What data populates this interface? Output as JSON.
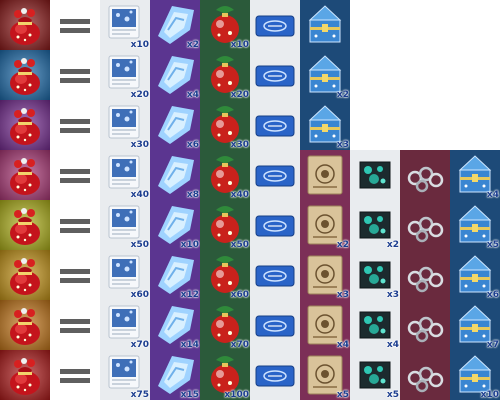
{
  "colors": {
    "bag_backgrounds": [
      "#8f1c1c",
      "#1f6fb0",
      "#7a2f96",
      "#b03a7a",
      "#b3b51c",
      "#c9981a",
      "#c87a1c",
      "#b31c1c"
    ],
    "equals": "#5f5f5f",
    "quantity_text": "#1b3d8f"
  },
  "icons": {
    "gift_bag": "red-gift-bag-icon",
    "equals": "equals-icon",
    "card_scroll": "blue-card-scroll-icon",
    "ice_crystal": "ice-crystal-icon",
    "ornament_ball": "christmas-ornament-icon",
    "blue_ticket": "blue-ticket-icon",
    "treasure_chest": "blue-treasure-chest-icon",
    "parchment": "parchment-scroll-icon",
    "gem_box": "teal-gem-box-icon",
    "chain_pile": "silver-chain-pile-icon"
  },
  "rows": [
    {
      "items": [
        {
          "icon": "card_scroll",
          "qty": "x10"
        },
        {
          "icon": "ice_crystal",
          "qty": "x2"
        },
        {
          "icon": "ornament_ball",
          "qty": "x10"
        },
        {
          "icon": "blue_ticket",
          "qty": ""
        },
        {
          "icon": "treasure_chest",
          "qty": ""
        }
      ]
    },
    {
      "items": [
        {
          "icon": "card_scroll",
          "qty": "x20"
        },
        {
          "icon": "ice_crystal",
          "qty": "x4"
        },
        {
          "icon": "ornament_ball",
          "qty": "x20"
        },
        {
          "icon": "blue_ticket",
          "qty": ""
        },
        {
          "icon": "treasure_chest",
          "qty": "x2"
        }
      ]
    },
    {
      "items": [
        {
          "icon": "card_scroll",
          "qty": "x30"
        },
        {
          "icon": "ice_crystal",
          "qty": "x6"
        },
        {
          "icon": "ornament_ball",
          "qty": "x30"
        },
        {
          "icon": "blue_ticket",
          "qty": ""
        },
        {
          "icon": "treasure_chest",
          "qty": "x3"
        }
      ]
    },
    {
      "items": [
        {
          "icon": "card_scroll",
          "qty": "x40"
        },
        {
          "icon": "ice_crystal",
          "qty": "x8"
        },
        {
          "icon": "ornament_ball",
          "qty": "x40"
        },
        {
          "icon": "blue_ticket",
          "qty": ""
        },
        {
          "icon": "parchment",
          "qty": ""
        },
        {
          "icon": "gem_box",
          "qty": ""
        },
        {
          "icon": "chain_pile",
          "qty": ""
        },
        {
          "icon": "treasure_chest",
          "qty": "x4"
        }
      ]
    },
    {
      "items": [
        {
          "icon": "card_scroll",
          "qty": "x50"
        },
        {
          "icon": "ice_crystal",
          "qty": "x10"
        },
        {
          "icon": "ornament_ball",
          "qty": "x50"
        },
        {
          "icon": "blue_ticket",
          "qty": ""
        },
        {
          "icon": "parchment",
          "qty": "x2"
        },
        {
          "icon": "gem_box",
          "qty": "x2"
        },
        {
          "icon": "chain_pile",
          "qty": ""
        },
        {
          "icon": "treasure_chest",
          "qty": "x5"
        }
      ]
    },
    {
      "items": [
        {
          "icon": "card_scroll",
          "qty": "x60"
        },
        {
          "icon": "ice_crystal",
          "qty": "x12"
        },
        {
          "icon": "ornament_ball",
          "qty": "x60"
        },
        {
          "icon": "blue_ticket",
          "qty": ""
        },
        {
          "icon": "parchment",
          "qty": "x3"
        },
        {
          "icon": "gem_box",
          "qty": "x3"
        },
        {
          "icon": "chain_pile",
          "qty": ""
        },
        {
          "icon": "treasure_chest",
          "qty": "x6"
        }
      ]
    },
    {
      "items": [
        {
          "icon": "card_scroll",
          "qty": "x70"
        },
        {
          "icon": "ice_crystal",
          "qty": "x14"
        },
        {
          "icon": "ornament_ball",
          "qty": "x70"
        },
        {
          "icon": "blue_ticket",
          "qty": ""
        },
        {
          "icon": "parchment",
          "qty": "x4"
        },
        {
          "icon": "gem_box",
          "qty": "x4"
        },
        {
          "icon": "chain_pile",
          "qty": ""
        },
        {
          "icon": "treasure_chest",
          "qty": "x7"
        }
      ]
    },
    {
      "items": [
        {
          "icon": "card_scroll",
          "qty": "x75"
        },
        {
          "icon": "ice_crystal",
          "qty": "x15"
        },
        {
          "icon": "ornament_ball",
          "qty": "x100"
        },
        {
          "icon": "blue_ticket",
          "qty": ""
        },
        {
          "icon": "parchment",
          "qty": "x5"
        },
        {
          "icon": "gem_box",
          "qty": "x5"
        },
        {
          "icon": "chain_pile",
          "qty": ""
        },
        {
          "icon": "treasure_chest",
          "qty": "x10"
        }
      ]
    }
  ]
}
